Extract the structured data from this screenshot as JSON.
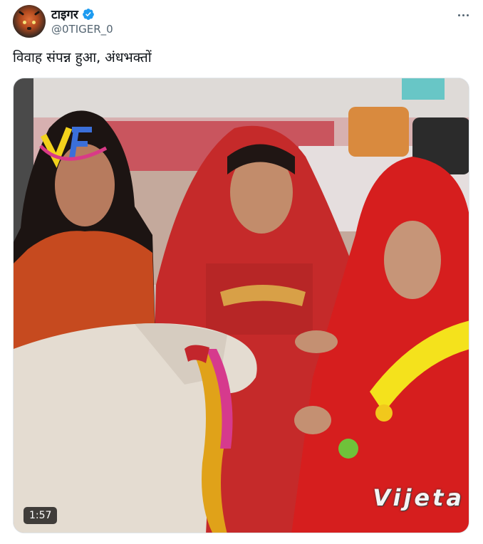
{
  "tweet": {
    "display_name": "टाइगर",
    "handle": "@0TIGER_0",
    "text": "विवाह संपन्न हुआ, अंधभक्तों",
    "verified": true,
    "verified_color": "#1d9bf0"
  },
  "media": {
    "type": "video",
    "duration": "1:57",
    "watermark": "Vijeta"
  }
}
